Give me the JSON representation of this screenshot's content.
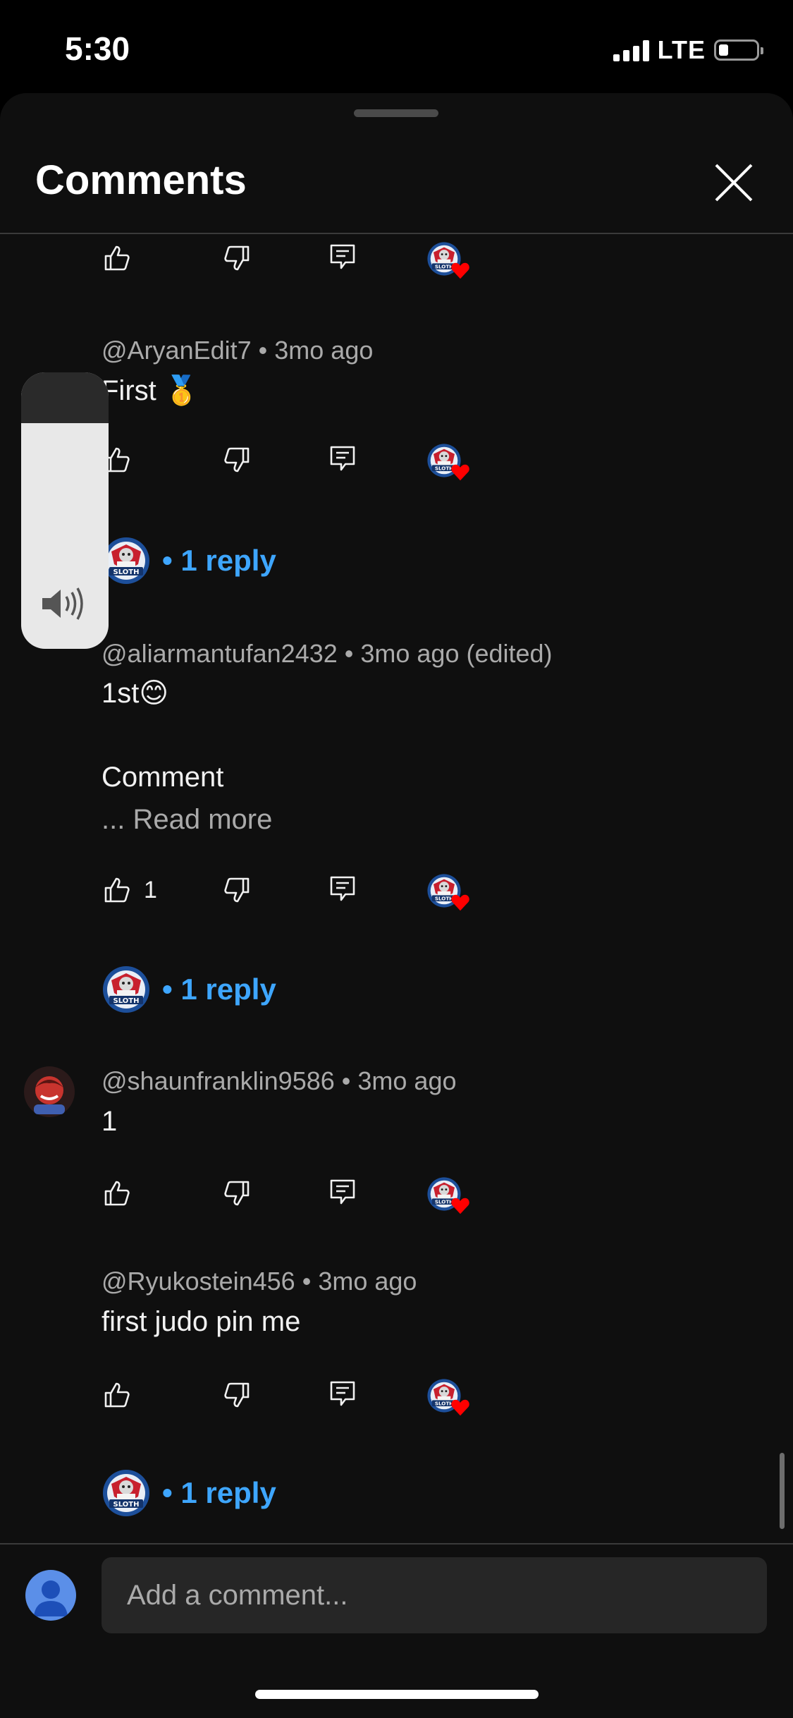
{
  "status_bar": {
    "time": "5:30",
    "network": "LTE"
  },
  "header": {
    "title": "Comments"
  },
  "comments": [
    {
      "author": "@AryanEdit7",
      "age": "3mo ago",
      "text": "First 🥇",
      "likes": "",
      "reply_label": "1 reply"
    },
    {
      "author": "@aliarmantufan2432",
      "age": "3mo ago (edited)",
      "text": "1st😊",
      "text2": "Comment",
      "read_more": "... Read more",
      "likes": "1",
      "reply_label": "1 reply"
    },
    {
      "author": "@shaunfranklin9586",
      "age": "3mo ago",
      "text": "1",
      "likes": ""
    },
    {
      "author": "@Ryukostein456",
      "age": "3mo ago",
      "text": "first judo pin me",
      "likes": "",
      "reply_label": "1 reply"
    }
  ],
  "dot": "•",
  "composer": {
    "placeholder": "Add a comment..."
  },
  "colors": {
    "background": "#0f0f0f",
    "link": "#3ea6ff",
    "heart": "#ff0000",
    "meta": "#aaaaaa"
  },
  "icons": [
    "like-icon",
    "dislike-icon",
    "reply-icon",
    "creator-heart-icon",
    "close-icon",
    "speaker-icon"
  ]
}
